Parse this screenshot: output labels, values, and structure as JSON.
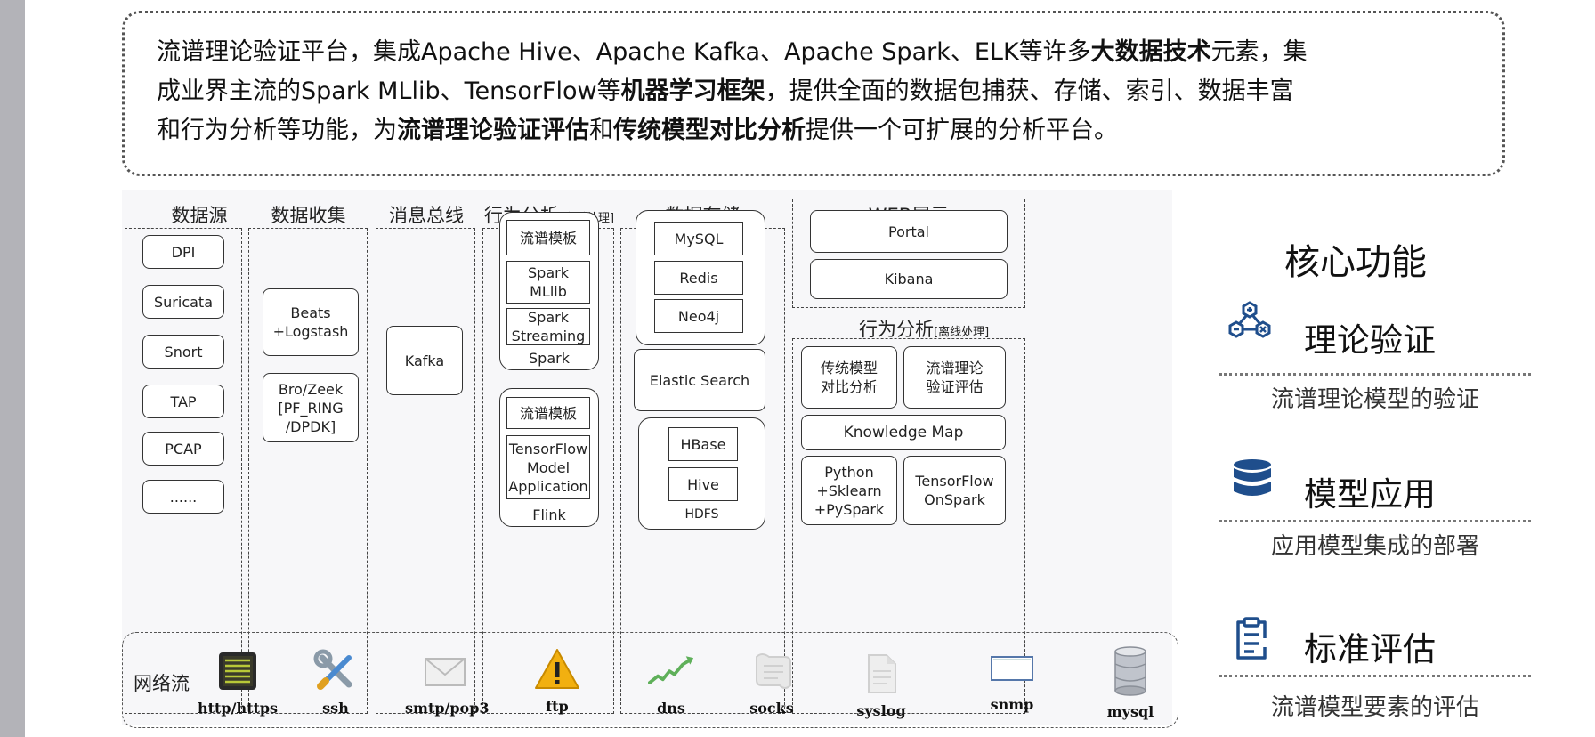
{
  "intro": {
    "line1_a": "流谱理论验证平台，集成Apache Hive、Apache Kafka、Apache Spark、ELK等许多",
    "line1_b": "大数据技术",
    "line1_c": "元素，集",
    "line2_a": "成业界主流的Spark MLlib、TensorFlow等",
    "line2_b": "机器学习框架",
    "line2_c": "，提供全面的数据包捕获、存储、索引、数据丰富",
    "line3_a": "和行为分析等功能，为",
    "line3_b": "流谱理论验证评估",
    "line3_c": "和",
    "line3_d": "传统模型对比分析",
    "line3_e": "提供一个可扩展的分析平台。"
  },
  "columns": {
    "sources": "数据源",
    "collect": "数据收集",
    "bus": "消息总线",
    "realtime_main": "行为分析",
    "realtime_sub": "[实时处理]",
    "storage": "数据存储",
    "web": "WEB展示"
  },
  "sources": [
    "DPI",
    "Suricata",
    "Snort",
    "TAP",
    "PCAP",
    "......"
  ],
  "collect": {
    "beats": "Beats\n+Logstash",
    "bro": "Bro/Zeek\n[PF_RING\n/DPDK]"
  },
  "bus": {
    "kafka": "Kafka"
  },
  "realtime": {
    "spark_items": [
      "流谱模板",
      "Spark\nMLlib",
      "Spark\nStreaming"
    ],
    "spark_label": "Spark",
    "flink_items": [
      "流谱模板",
      "TensorFlow\nModel\nApplication"
    ],
    "flink_label": "Flink"
  },
  "storage": {
    "db_items": [
      "MySQL",
      "Redis",
      "Neo4j"
    ],
    "elastic": "Elastic Search",
    "hdfs_items": [
      "HBase",
      "Hive"
    ],
    "hdfs_label": "HDFS"
  },
  "web": {
    "portal": "Portal",
    "kibana": "Kibana"
  },
  "offline": {
    "title_main": "行为分析",
    "title_sub": "[离线处理]",
    "traditional": "传统模型\n对比分析",
    "theory": "流谱理论\n验证评估",
    "knowledge": "Knowledge Map",
    "python": "Python\n+Sklearn\n+PySpark",
    "tfspark": "TensorFlow\nOnSpark"
  },
  "network": {
    "label": "网络流",
    "protocols": [
      "http/https",
      "ssh",
      "smtp/pop3",
      "ftp",
      "dns",
      "socks",
      "syslog",
      "snmp",
      "mysql"
    ]
  },
  "core": {
    "title": "核心功能",
    "features": [
      {
        "name": "理论验证",
        "desc": "流谱理论模型的验证",
        "icon": "network-nodes-icon"
      },
      {
        "name": "模型应用",
        "desc": "应用模型集成的部署",
        "icon": "database-stack-icon"
      },
      {
        "name": "标准评估",
        "desc": "流谱模型要素的评估",
        "icon": "clipboard-icon"
      }
    ],
    "accent": "#1f4e8c"
  }
}
